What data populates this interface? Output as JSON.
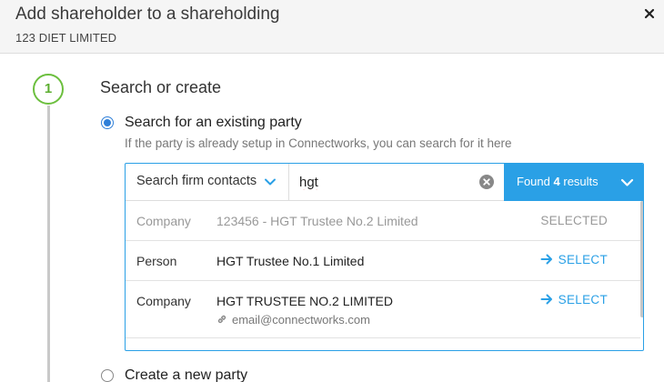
{
  "header": {
    "title": "Add shareholder to a shareholding",
    "subtitle": "123 DIET LIMITED"
  },
  "step": {
    "number": "1",
    "title": "Search or create"
  },
  "options": {
    "search_label": "Search for an existing party",
    "search_help": "If the party is already setup in Connectworks, you can search for it here",
    "create_label": "Create a new party",
    "selected": "search"
  },
  "search": {
    "filter_label": "Search firm contacts",
    "query": "hgt",
    "results_prefix": "Found",
    "results_count": "4",
    "results_suffix": "results"
  },
  "results": [
    {
      "type": "Company",
      "name": "123456 - HGT Trustee No.2 Limited",
      "email": "",
      "action": "SELECTED",
      "selected": true
    },
    {
      "type": "Person",
      "name": "HGT Trustee No.1 Limited",
      "email": "",
      "action": "SELECT",
      "selected": false
    },
    {
      "type": "Company",
      "name": "HGT TRUSTEE NO.2 LIMITED",
      "email": "email@connectworks.com",
      "action": "SELECT",
      "selected": false
    }
  ],
  "colors": {
    "accent": "#2aa0e6",
    "radio": "#2f7fd8",
    "step_green": "#6cbf3e"
  },
  "icons": {
    "close": "close-icon",
    "chevron": "chevron-down-icon",
    "clear": "clear-icon",
    "arrow": "arrow-right-icon",
    "link": "link-icon"
  }
}
